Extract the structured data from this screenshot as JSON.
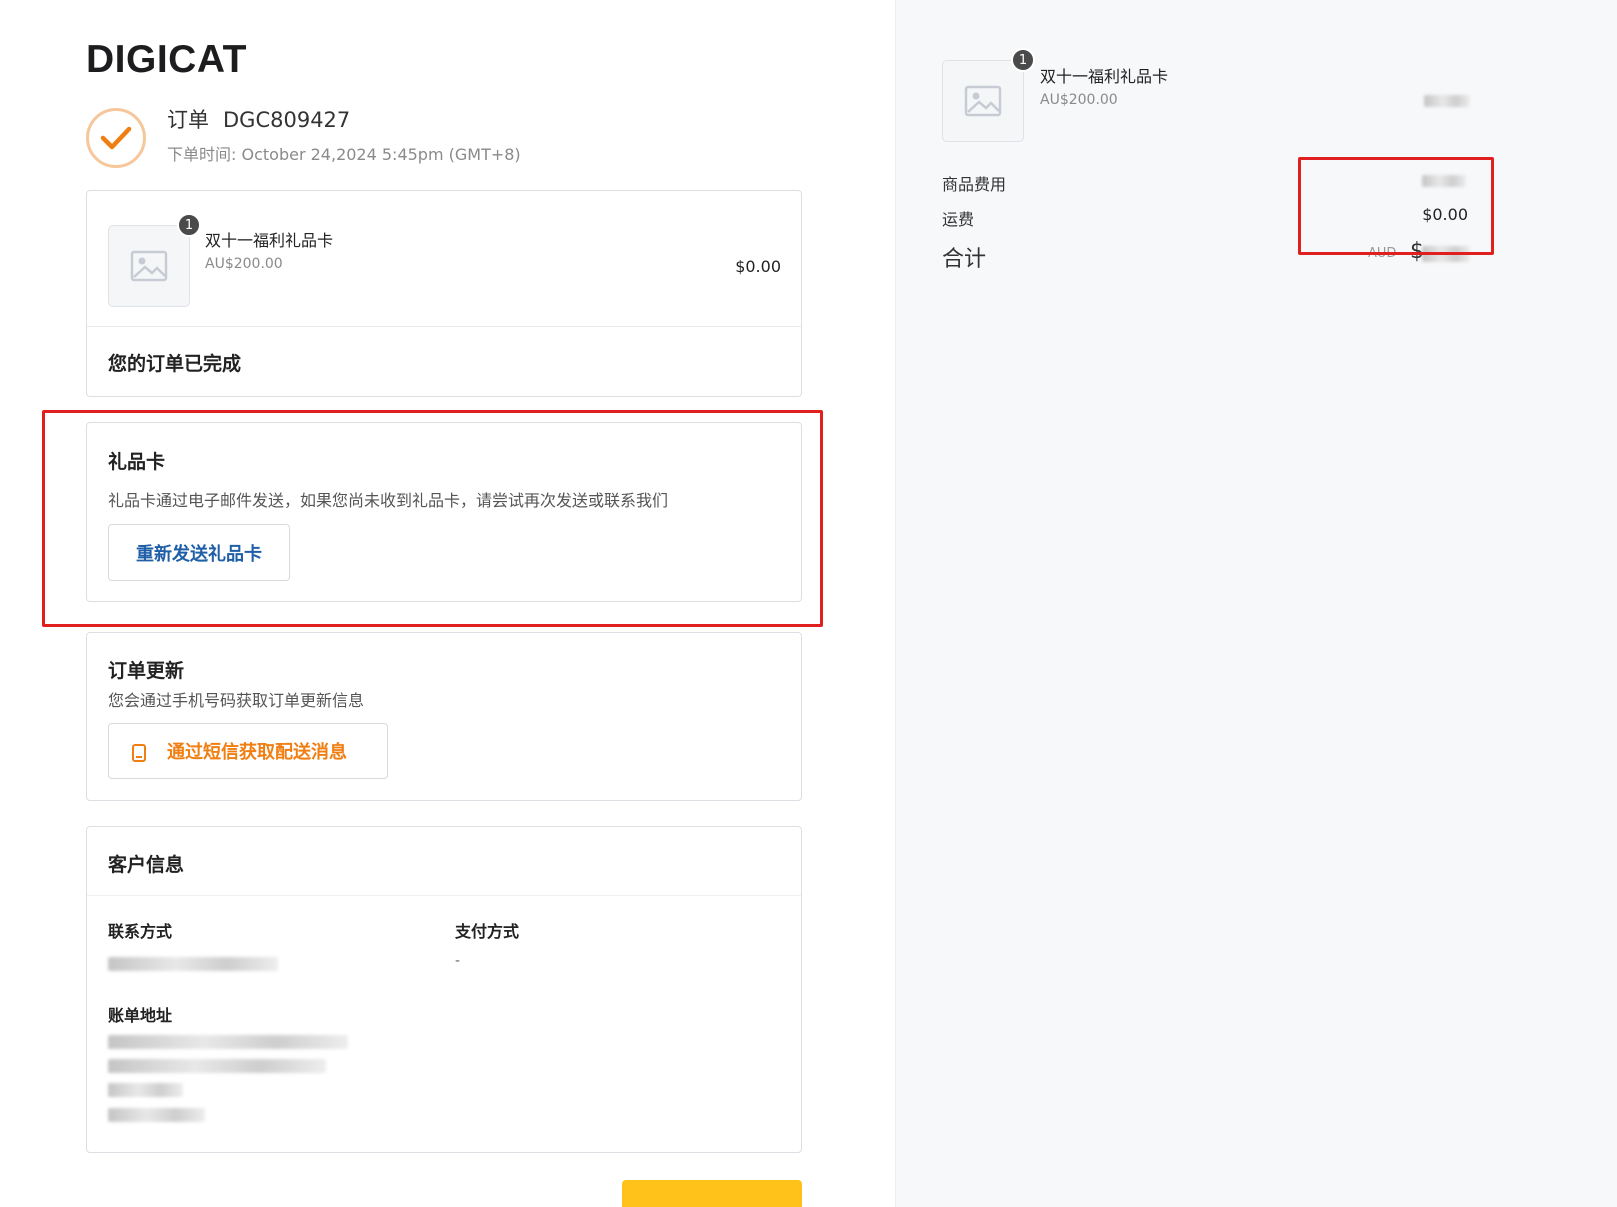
{
  "brand": {
    "logo": "DIGICAT"
  },
  "order": {
    "label": "订单",
    "number": "DGC809427",
    "time_label": "下单时间:",
    "time_value": "October 24,2024 5:45pm (GMT+8)"
  },
  "item": {
    "quantity": "1",
    "name": "双十一福利礼品卡",
    "face_value": "AU$200.00",
    "price": "$0.00"
  },
  "status": {
    "message": "您的订单已完成"
  },
  "gift_card": {
    "title": "礼品卡",
    "description": "礼品卡通过电子邮件发送，如果您尚未收到礼品卡，请尝试再次发送或联系我们",
    "resend_button": "重新发送礼品卡"
  },
  "order_updates": {
    "title": "订单更新",
    "description": "您会通过手机号码获取订单更新信息",
    "sms_button": "通过短信获取配送消息"
  },
  "customer": {
    "title": "客户信息",
    "contact_label": "联系方式",
    "payment_label": "支付方式",
    "payment_value": "-",
    "billing_label": "账单地址"
  },
  "summary": {
    "item_quantity": "1",
    "item_name": "双十一福利礼品卡",
    "item_face_value": "AU$200.00",
    "subtotal_label": "商品费用",
    "shipping_label": "运费",
    "shipping_value": "$0.00",
    "total_label": "合计",
    "total_currency": "AUD",
    "total_symbol": "$"
  },
  "colors": {
    "accent_orange": "#f07f13",
    "link_blue": "#1f5fa8",
    "highlight_red": "#e0201e",
    "cta_yellow": "#ffc21a"
  }
}
